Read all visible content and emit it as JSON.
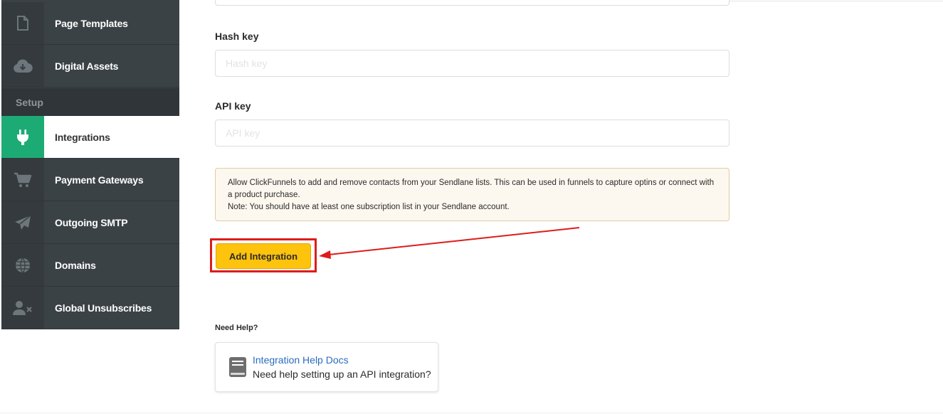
{
  "sidebar": {
    "items": [
      {
        "label": "Page Templates",
        "icon": "file-icon"
      },
      {
        "label": "Digital Assets",
        "icon": "cloud-download-icon"
      },
      {
        "label": "Integrations",
        "icon": "plug-icon",
        "active": true
      },
      {
        "label": "Payment Gateways",
        "icon": "cart-icon"
      },
      {
        "label": "Outgoing SMTP",
        "icon": "paper-plane-icon"
      },
      {
        "label": "Domains",
        "icon": "globe-icon"
      },
      {
        "label": "Global Unsubscribes",
        "icon": "user-remove-icon"
      }
    ],
    "section_header": "Setup",
    "active_color": "#1dab75"
  },
  "form": {
    "hash_key": {
      "label": "Hash key",
      "placeholder": "Hash key",
      "value": ""
    },
    "api_key": {
      "label": "API key",
      "placeholder": "API key",
      "value": ""
    },
    "info_line1": "Allow ClickFunnels to add and remove contacts from your Sendlane lists. This can be used in funnels to capture optins or connect with a product purchase.",
    "info_line2": "Note: You should have at least one subscription list in your Sendlane account.",
    "submit_label": "Add Integration"
  },
  "help": {
    "heading": "Need Help?",
    "link_title": "Integration Help Docs",
    "link_subtitle": "Need help setting up an API integration?"
  },
  "annotation": {
    "highlight_color": "#e01b1b"
  }
}
